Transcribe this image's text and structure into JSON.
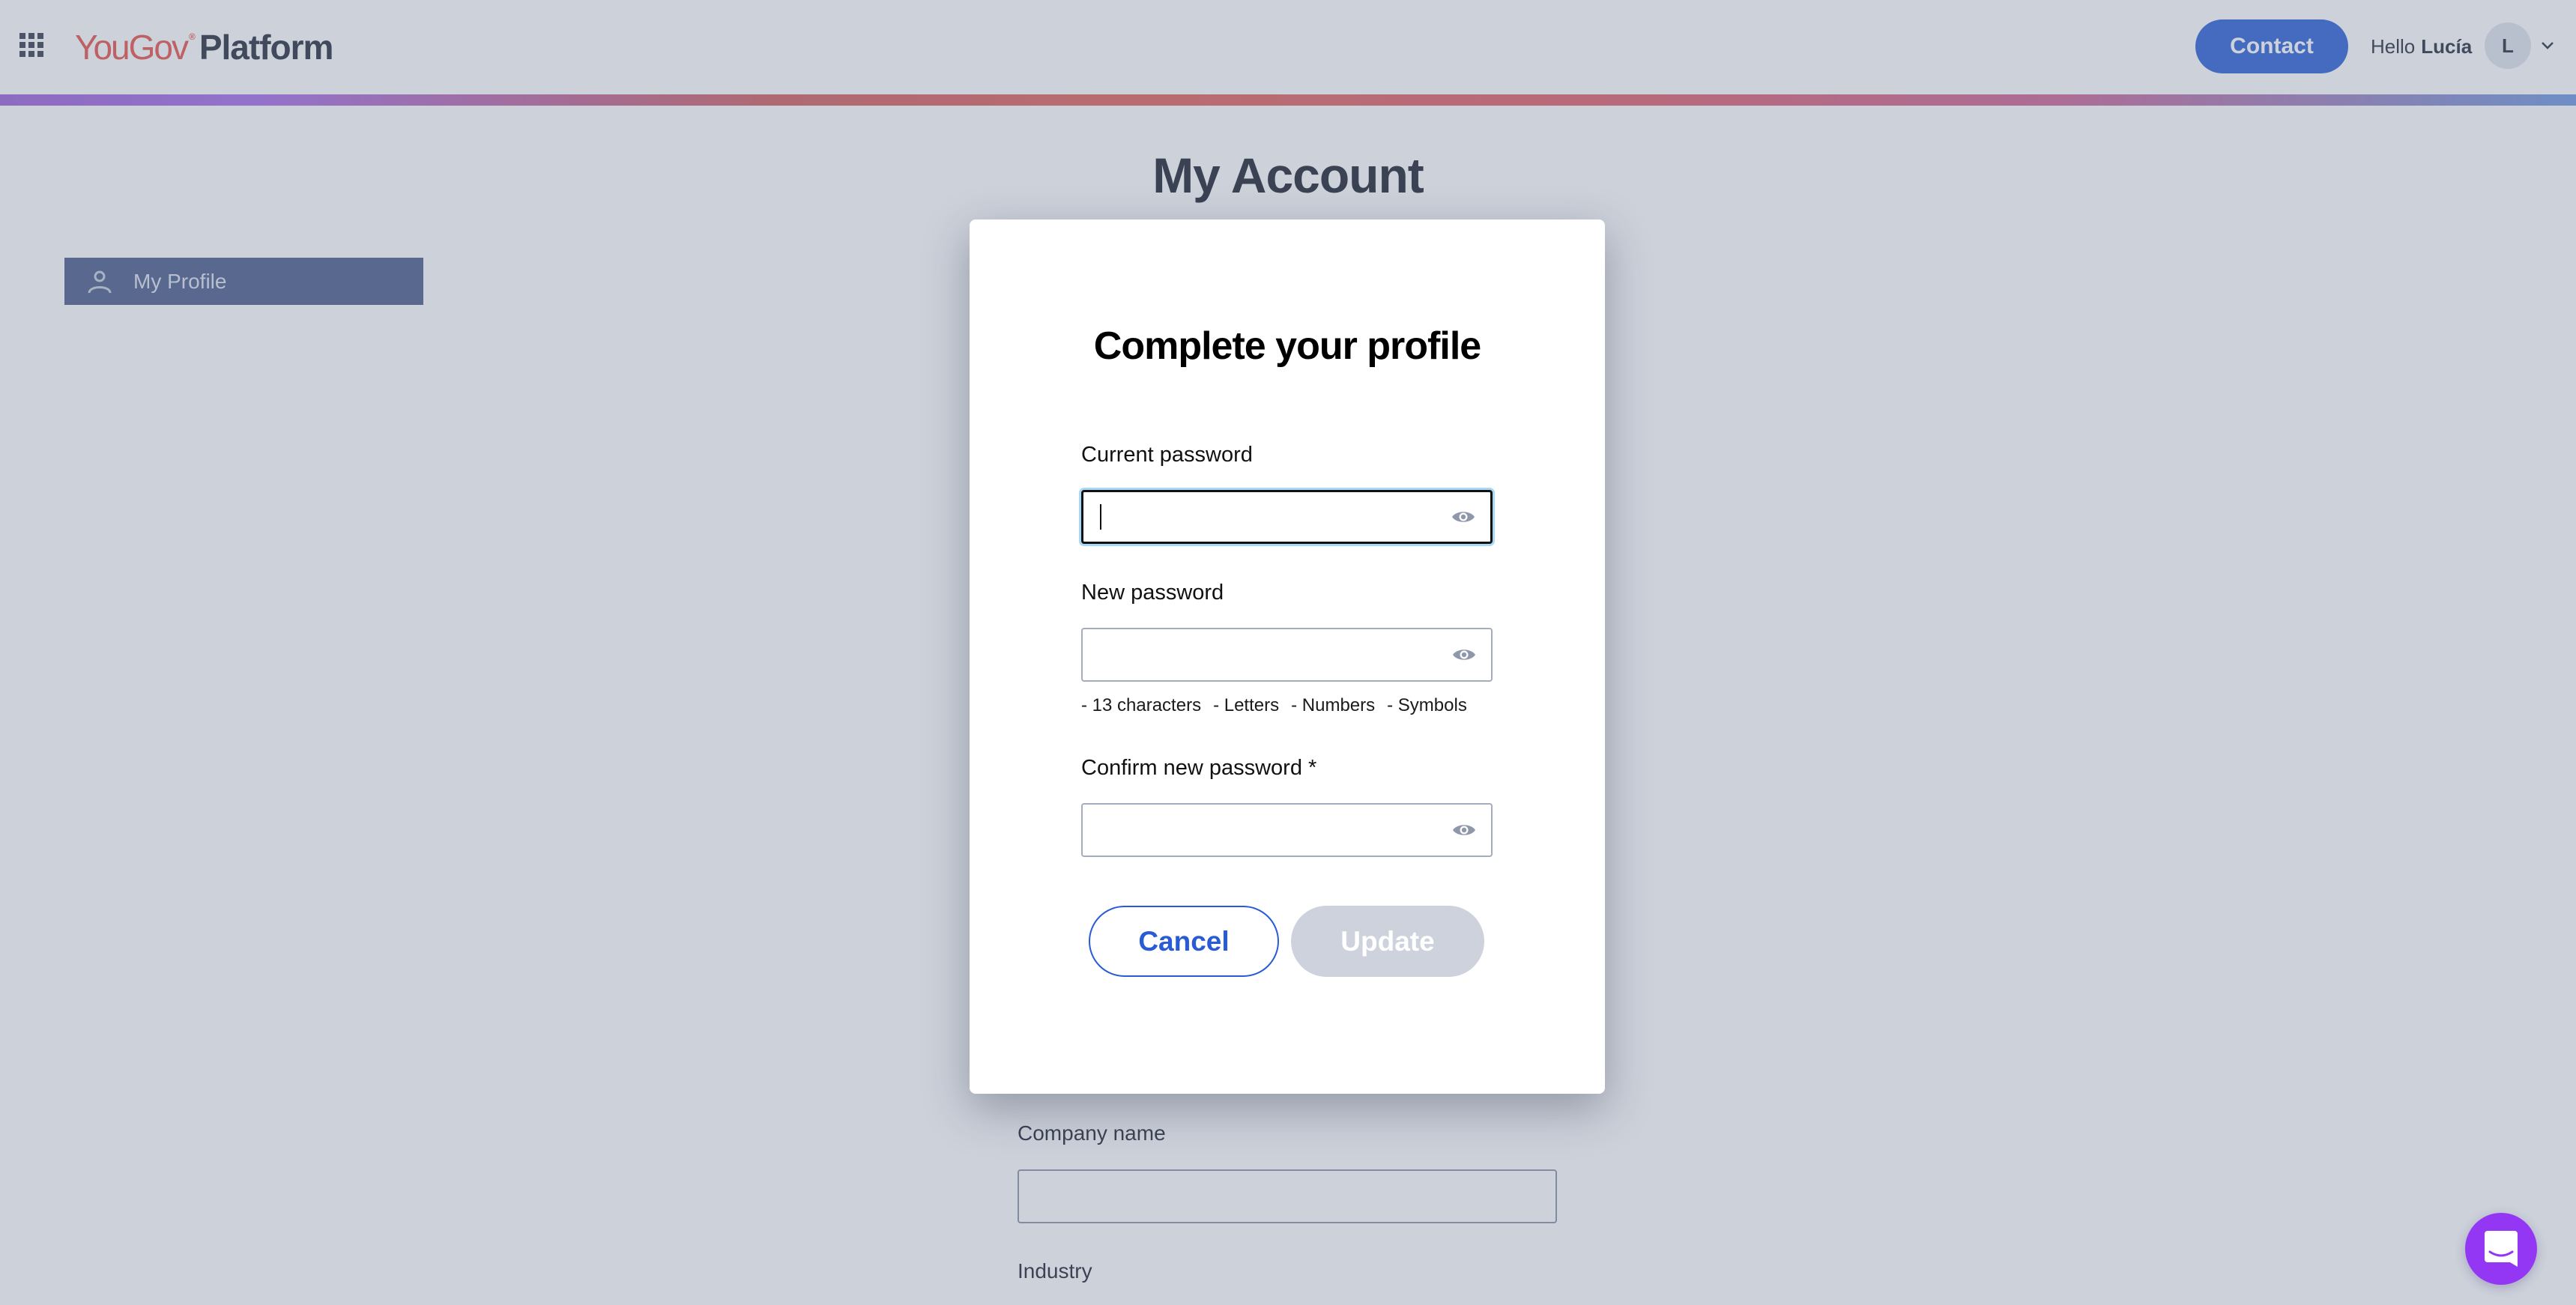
{
  "header": {
    "apps_icon": "apps-grid-icon",
    "logo_brand": "YouGov",
    "logo_registered": "®",
    "logo_product": "Platform",
    "contact_label": "Contact",
    "greeting": "Hello",
    "user_name": "Lucía",
    "avatar_initial": "L",
    "user_menu_icon": "chevron-down-icon"
  },
  "accent_gradient": [
    "#9d63d8",
    "#e2655c",
    "#df6170",
    "#6f9ae0"
  ],
  "page": {
    "title": "My Account"
  },
  "sidebar": {
    "items": [
      {
        "label": "My Profile",
        "icon": "user-icon",
        "active": true
      }
    ]
  },
  "background_form": {
    "fields": [
      {
        "label": "Company name",
        "value": ""
      },
      {
        "label": "Industry"
      }
    ]
  },
  "modal": {
    "title": "Complete your profile",
    "fields": [
      {
        "label": "Current password",
        "value": "",
        "focused": true,
        "toggle_icon": "eye-icon"
      },
      {
        "label": "New password",
        "value": "",
        "focused": false,
        "toggle_icon": "eye-icon"
      },
      {
        "label": "Confirm new password *",
        "value": "",
        "focused": false,
        "toggle_icon": "eye-icon"
      }
    ],
    "password_hints": [
      "- 13 characters",
      "- Letters",
      "- Numbers",
      "- Symbols"
    ],
    "cancel_label": "Cancel",
    "update_label": "Update",
    "update_disabled": true
  },
  "chat": {
    "icon": "chat-bubble-icon",
    "color": "#9437f5"
  },
  "colors": {
    "primary": "#2a5bd7",
    "contact_button": "#2f63d6",
    "brand": "#e8534a",
    "sidebar_active": "#4d5f8a",
    "focus_ring": "#a8d8f5"
  }
}
